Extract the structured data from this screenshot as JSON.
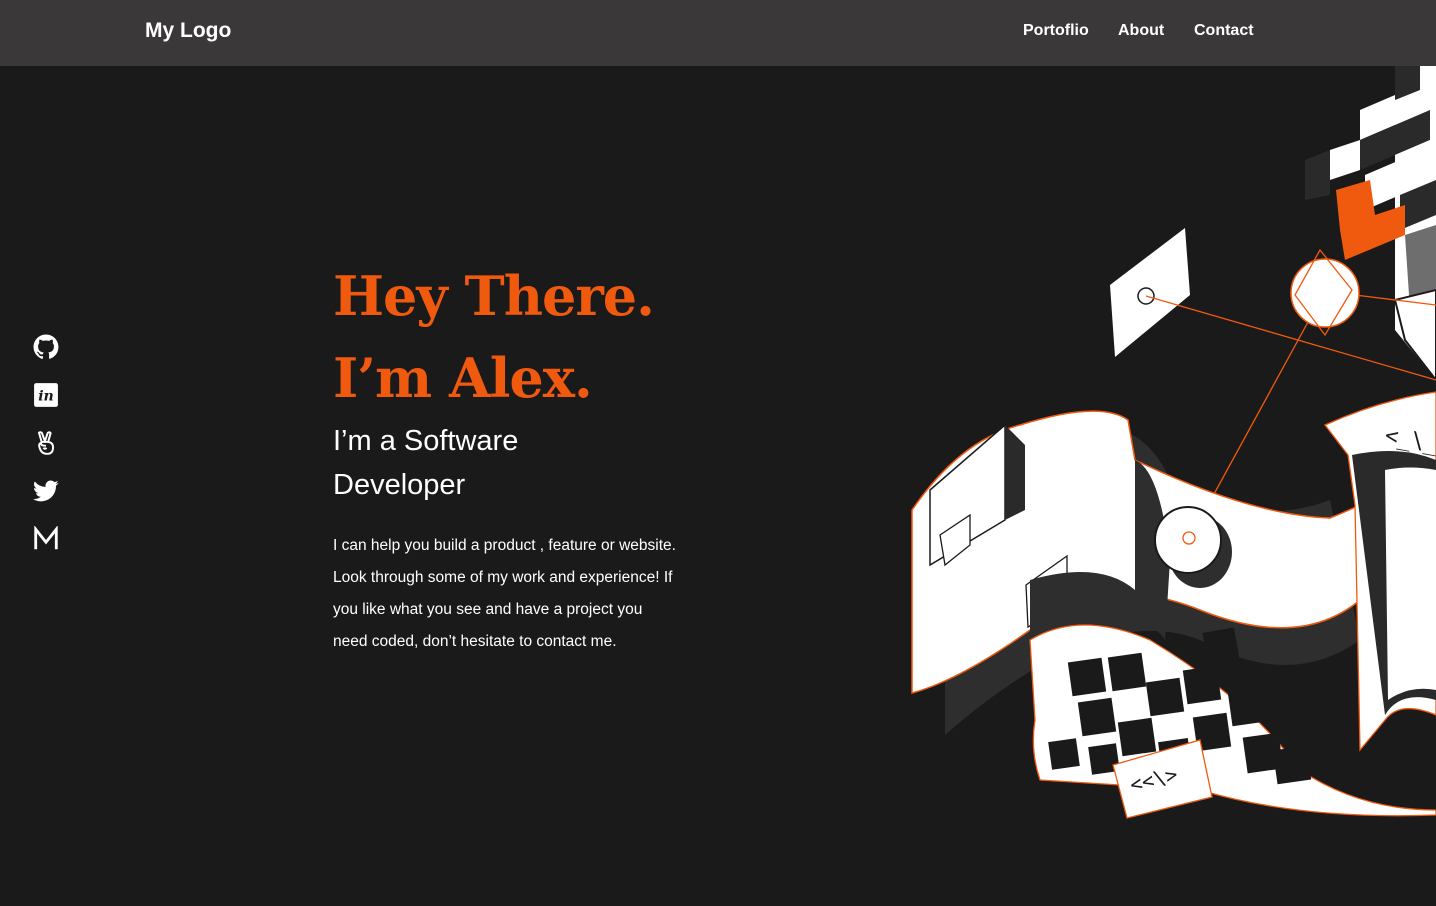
{
  "header": {
    "logo": "My Logo",
    "nav": [
      {
        "label": "Portoflio"
      },
      {
        "label": "About"
      },
      {
        "label": "Contact"
      }
    ]
  },
  "social": [
    {
      "icon": "github-icon"
    },
    {
      "icon": "linkedin-icon"
    },
    {
      "icon": "angellist-icon"
    },
    {
      "icon": "twitter-icon"
    },
    {
      "icon": "medium-icon"
    }
  ],
  "hero": {
    "greeting_line1": "Hey There.",
    "greeting_line2": "I’m Alex.",
    "role": "I’m a Software Developer",
    "intro": "I can help you build a product , feature or website. Look through some of my work and experience! If you like what you see and have a project you need coded, don’t hesitate to contact me.",
    "code_tag_top": "<_\\_",
    "code_tag_bottom": "<<\\>"
  },
  "colors": {
    "accent": "#f05a0f",
    "background": "#1b1a1a",
    "navbar": "#3a3839",
    "text": "#ffffff"
  }
}
